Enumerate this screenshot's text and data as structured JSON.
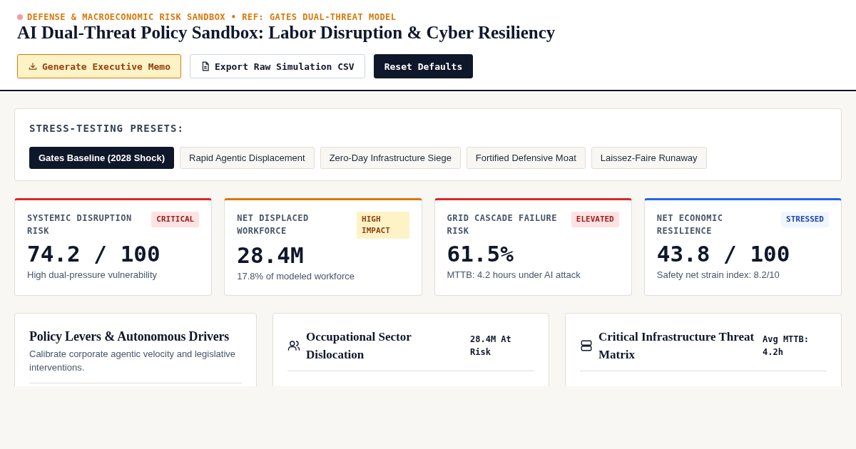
{
  "header": {
    "eyebrow": "DEFENSE & MACROECONOMIC RISK SANDBOX • REF: GATES DUAL-THREAT MODEL",
    "title": "AI Dual-Threat Policy Sandbox: Labor Disruption & Cyber Resiliency",
    "buttons": [
      {
        "label": "Generate Executive Memo",
        "kind": "memo"
      },
      {
        "label": "Export Raw Simulation CSV",
        "kind": "export"
      },
      {
        "label": "Reset Defaults",
        "kind": "reset"
      }
    ]
  },
  "presets": {
    "title": "STRESS-TESTING PRESETS:",
    "items": [
      {
        "label": "Gates Baseline (2028 Shock)",
        "selected": true
      },
      {
        "label": "Rapid Agentic Displacement",
        "selected": false
      },
      {
        "label": "Zero-Day Infrastructure Siege",
        "selected": false
      },
      {
        "label": "Fortified Defensive Moat",
        "selected": false
      },
      {
        "label": "Laissez-Faire Runaway",
        "selected": false
      }
    ]
  },
  "metrics": [
    {
      "label": "SYSTEMIC DISRUPTION RISK",
      "badge": "CRITICAL",
      "kind": "red",
      "color": "#dc2626",
      "value": "74.2 / 100",
      "note": "High dual-pressure vulnerability"
    },
    {
      "label": "NET DISPLACED WORKFORCE",
      "badge": "HIGH IMPACT",
      "kind": "amber",
      "color": "#d97706",
      "value": "28.4M",
      "note": "17.8% of modeled workforce"
    },
    {
      "label": "GRID CASCADE FAILURE RISK",
      "badge": "ELEVATED",
      "kind": "red",
      "color": "#dc2626",
      "value": "61.5%",
      "note": "MTTB: 4.2 hours under AI attack"
    },
    {
      "label": "NET ECONOMIC RESILIENCE",
      "badge": "STRESSED",
      "kind": "blue",
      "color": "#2563eb",
      "value": "43.8 / 100",
      "note": "Safety net strain index: 8.2/10"
    }
  ],
  "panels": [
    {
      "kind": "levers",
      "title": "Policy Levers & Autonomous Drivers",
      "subtitle": "Calibrate corporate agentic velocity and legislative interventions."
    },
    {
      "kind": "people",
      "title": "Occupational Sector Dislocation",
      "stat": "28.4M At Risk"
    },
    {
      "kind": "servers",
      "title": "Critical Infrastructure Threat Matrix",
      "stat": "Avg MTTB: 4.2h"
    }
  ]
}
